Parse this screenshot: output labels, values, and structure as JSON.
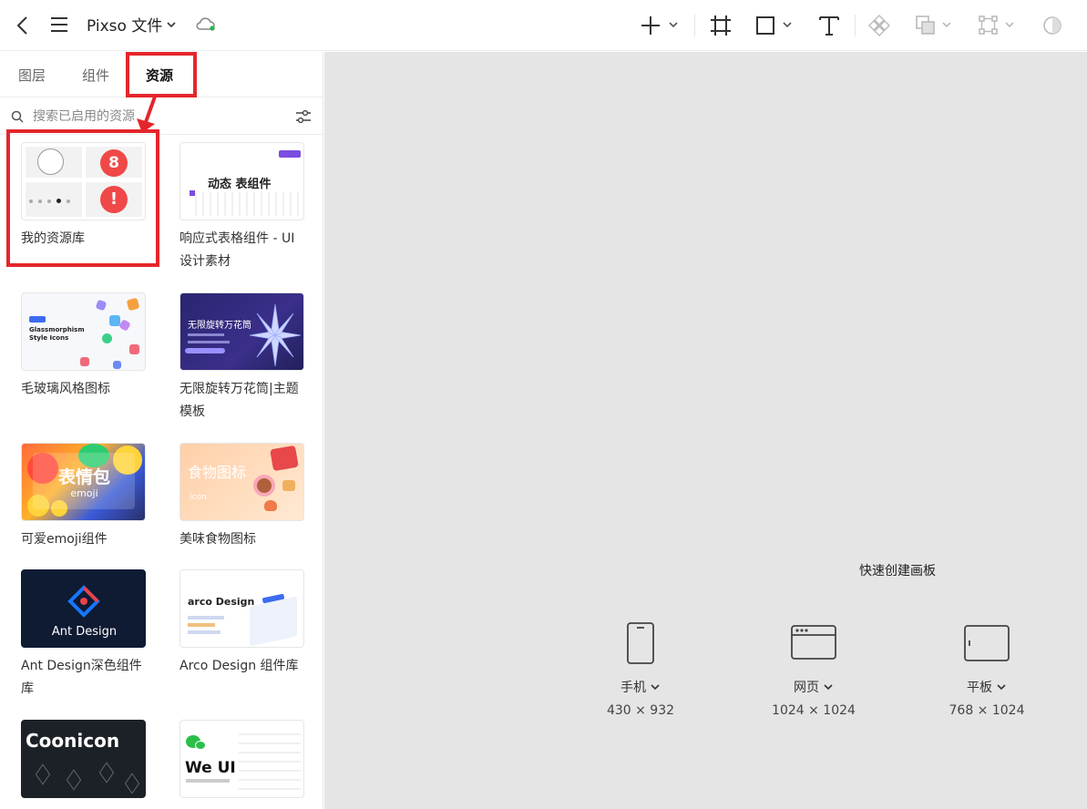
{
  "header": {
    "title": "Pixso 文件",
    "tools": [
      "add",
      "frame",
      "shape",
      "text",
      "component",
      "boolean",
      "instance",
      "theme"
    ]
  },
  "tabs": [
    {
      "label": "图层",
      "active": false
    },
    {
      "label": "组件",
      "active": false
    },
    {
      "label": "资源",
      "active": true
    }
  ],
  "search": {
    "placeholder": "搜索已启用的资源"
  },
  "libraries": [
    {
      "name": "我的资源库",
      "badge_count": "8",
      "badge_alert": "!"
    },
    {
      "name": "响应式表格组件 - UI设计素材",
      "thumb_text": "动态 表组件"
    },
    {
      "name": "毛玻璃风格图标",
      "thumb_text": "Glassmorphism Style Icons"
    },
    {
      "name": "无限旋转万花筒|主题模板",
      "thumb_text": "无限旋转万花筒"
    },
    {
      "name": "可爱emoji组件",
      "thumb_text": "表情包",
      "thumb_sub": "emoji"
    },
    {
      "name": "美味食物图标",
      "thumb_text": "食物图标",
      "thumb_sub": "icon"
    },
    {
      "name": "Ant Design深色组件库",
      "thumb_text": "Ant Design"
    },
    {
      "name": "Arco Design 组件库",
      "thumb_text": "arco Design"
    },
    {
      "name": "",
      "thumb_text": "Coonicon"
    },
    {
      "name": "",
      "thumb_text": "We UI"
    }
  ],
  "quick_create": {
    "title": "快速创建画板",
    "presets": [
      {
        "label": "手机",
        "size": "430 × 932"
      },
      {
        "label": "网页",
        "size": "1024 × 1024"
      },
      {
        "label": "平板",
        "size": "768 × 1024"
      }
    ]
  },
  "colors": {
    "highlight": "#e4262c",
    "canvas": "#e5e5e5",
    "alert_red": "#f04848"
  }
}
